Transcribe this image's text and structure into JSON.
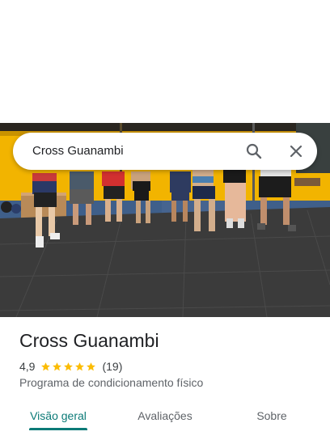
{
  "search": {
    "query": "Cross Guanambi"
  },
  "place": {
    "title": "Cross Guanambi",
    "rating": "4,9",
    "stars": 5,
    "review_count": "(19)",
    "category": "Programa de condicionamento físico"
  },
  "tabs": [
    {
      "label": "Visão geral",
      "active": true
    },
    {
      "label": "Avaliações",
      "active": false
    },
    {
      "label": "Sobre",
      "active": false
    }
  ],
  "colors": {
    "accent": "#0b7a77",
    "star": "#fbbc04",
    "wall": "#f2b400"
  },
  "icons": [
    "search-icon",
    "close-icon",
    "star-icon"
  ]
}
